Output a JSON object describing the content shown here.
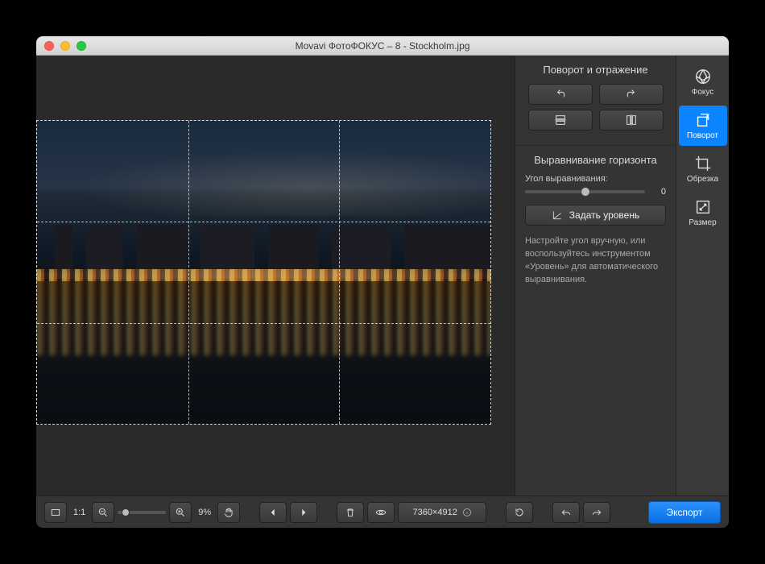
{
  "window": {
    "title": "Movavi ФотоФОКУС – 8 - Stockholm.jpg"
  },
  "rail": {
    "focus": {
      "label": "Фокус"
    },
    "rotate": {
      "label": "Поворот",
      "active": true
    },
    "crop": {
      "label": "Обрезка"
    },
    "size": {
      "label": "Размер"
    }
  },
  "panel": {
    "rotation": {
      "title": "Поворот и отражение"
    },
    "horizon": {
      "title": "Выравнивание горизонта",
      "angle_label": "Угол выравнивания:",
      "angle_value": "0",
      "level_button": "Задать уровень",
      "hint": "Настройте угол вручную, или воспользуйтесь инструментом «Уровень» для автоматического выравнивания."
    }
  },
  "bottombar": {
    "fit_label": "1:1",
    "zoom_percent": "9%",
    "dimensions": "7360×4912",
    "export": "Экспорт"
  }
}
